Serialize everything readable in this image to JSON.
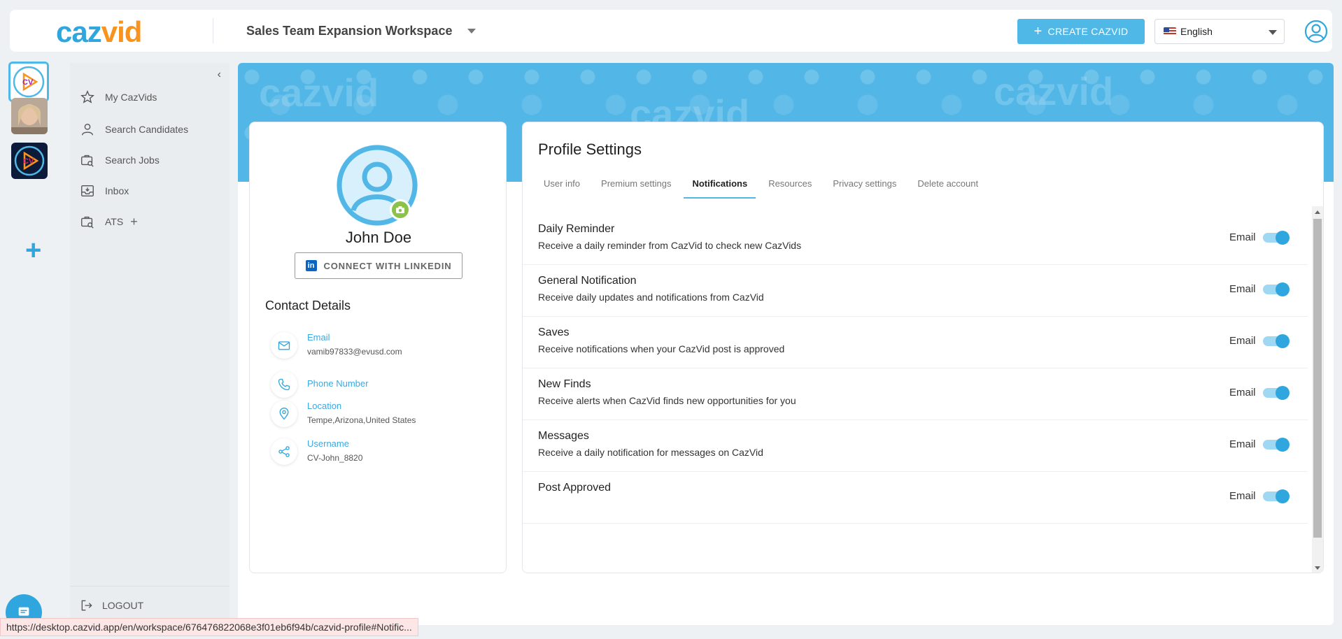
{
  "header": {
    "logo_part1": "caz",
    "logo_part2": "vid",
    "workspace_name": "Sales Team Expansion Workspace",
    "create_button": "CREATE CAZVID",
    "language": "English"
  },
  "rail": {
    "avatar_initials": "CV"
  },
  "sidebar": {
    "items": [
      {
        "label": "My CazVids",
        "icon": "star-icon"
      },
      {
        "label": "Search Candidates",
        "icon": "person-icon"
      },
      {
        "label": "Search Jobs",
        "icon": "job-search-icon"
      },
      {
        "label": "Inbox",
        "icon": "inbox-icon"
      },
      {
        "label": "ATS",
        "icon": "ats-icon"
      }
    ],
    "ats_add": "+",
    "logout": "LOGOUT"
  },
  "banner": {
    "watermark": "cazvid"
  },
  "profile": {
    "name": "John Doe",
    "linkedin_button": "CONNECT WITH LINKEDIN",
    "linkedin_logo": "in",
    "contact_title": "Contact Details",
    "contacts": [
      {
        "label": "Email",
        "value": "vamib97833@evusd.com",
        "icon": "mail-icon"
      },
      {
        "label": "Phone Number",
        "value": "",
        "icon": "phone-icon"
      },
      {
        "label": "Location",
        "value": "Tempe,Arizona,United States",
        "icon": "location-icon"
      },
      {
        "label": "Username",
        "value": "CV-John_8820",
        "icon": "share-icon"
      }
    ]
  },
  "settings": {
    "title": "Profile Settings",
    "tabs": [
      "User info",
      "Premium settings",
      "Notifications",
      "Resources",
      "Privacy settings",
      "Delete account"
    ],
    "active_tab": "Notifications",
    "channel_label": "Email",
    "notifications": [
      {
        "title": "Daily Reminder",
        "desc": "Receive a daily reminder from CazVid to check new CazVids",
        "enabled": true
      },
      {
        "title": "General Notification",
        "desc": "Receive daily updates and notifications from CazVid",
        "enabled": true
      },
      {
        "title": "Saves",
        "desc": "Receive notifications when your CazVid post is approved",
        "enabled": true
      },
      {
        "title": "New Finds",
        "desc": "Receive alerts when CazVid finds new opportunities for you",
        "enabled": true
      },
      {
        "title": "Messages",
        "desc": "Receive a daily notification for messages on CazVid",
        "enabled": true
      },
      {
        "title": "Post Approved",
        "desc": "",
        "enabled": true
      }
    ]
  },
  "status_url": "https://desktop.cazvid.app/en/workspace/676476822068e3f01eb6f94b/cazvid-profile#Notific...",
  "colors": {
    "accent": "#2fa7de",
    "brand_orange": "#f7931e",
    "banner": "#52b7e7"
  }
}
